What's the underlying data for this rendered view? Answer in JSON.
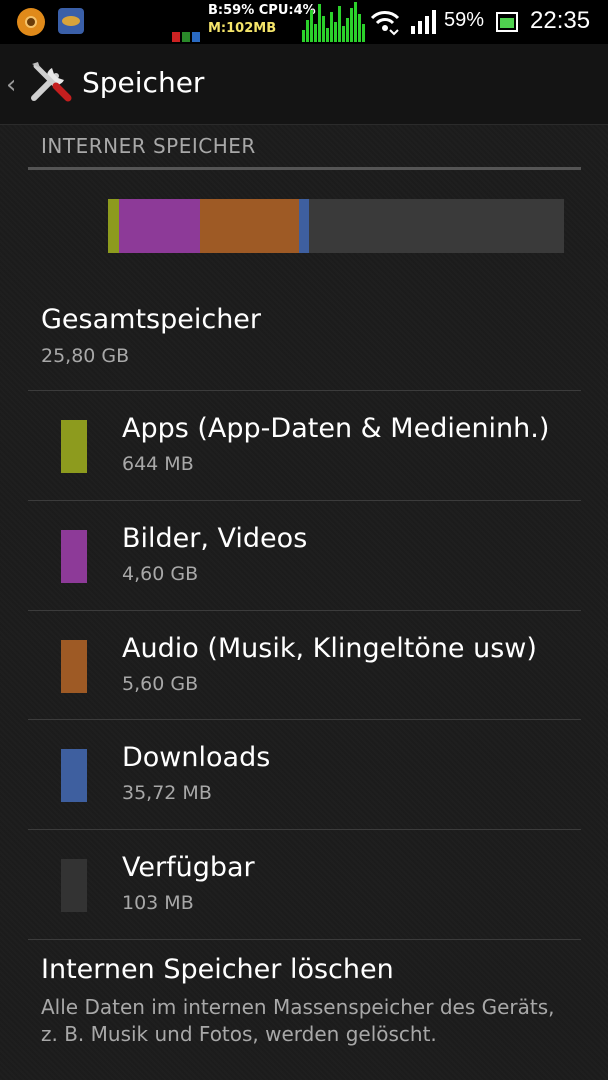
{
  "status_bar": {
    "monitor_line1": "B:59% CPU:4%",
    "monitor_line2": "M:102MB",
    "battery_percent": "59%",
    "time": "22:35",
    "icons": [
      "notification-app-icon",
      "notification-app-icon-2",
      "wifi-icon",
      "signal-icon",
      "battery-icon"
    ]
  },
  "action_bar": {
    "back_glyph": "‹",
    "title": "Speicher",
    "icon": "tools-icon"
  },
  "storage": {
    "section_header": "INTERNER SPEICHER",
    "total_label": "Gesamtspeicher",
    "total_value": "25,80 GB",
    "usage_bar": [
      {
        "name": "apps",
        "color": "#8d9b1e",
        "fraction": 0.024
      },
      {
        "name": "images",
        "color": "#8d3a98",
        "fraction": 0.178
      },
      {
        "name": "audio",
        "color": "#9e5a25",
        "fraction": 0.217
      },
      {
        "name": "downloads",
        "color": "#3e5f9f",
        "fraction": 0.022
      },
      {
        "name": "available",
        "color": "#3a3a3a",
        "fraction": 0.559
      }
    ],
    "categories": [
      {
        "label": "Apps (App-Daten & Medieninh.)",
        "value": "644 MB",
        "color": "#8d9b1e"
      },
      {
        "label": "Bilder, Videos",
        "value": "4,60 GB",
        "color": "#8d3a98"
      },
      {
        "label": "Audio (Musik, Klingeltöne usw)",
        "value": "5,60 GB",
        "color": "#9e5a25"
      },
      {
        "label": "Downloads",
        "value": "35,72 MB",
        "color": "#3e5f9f"
      },
      {
        "label": "Verfügbar",
        "value": "103 MB",
        "color": "#333333"
      }
    ]
  },
  "erase": {
    "title": "Internen Speicher löschen",
    "description": "Alle Daten im internen Massenspeicher des Geräts, z. B. Musik und Fotos, werden gelöscht."
  }
}
